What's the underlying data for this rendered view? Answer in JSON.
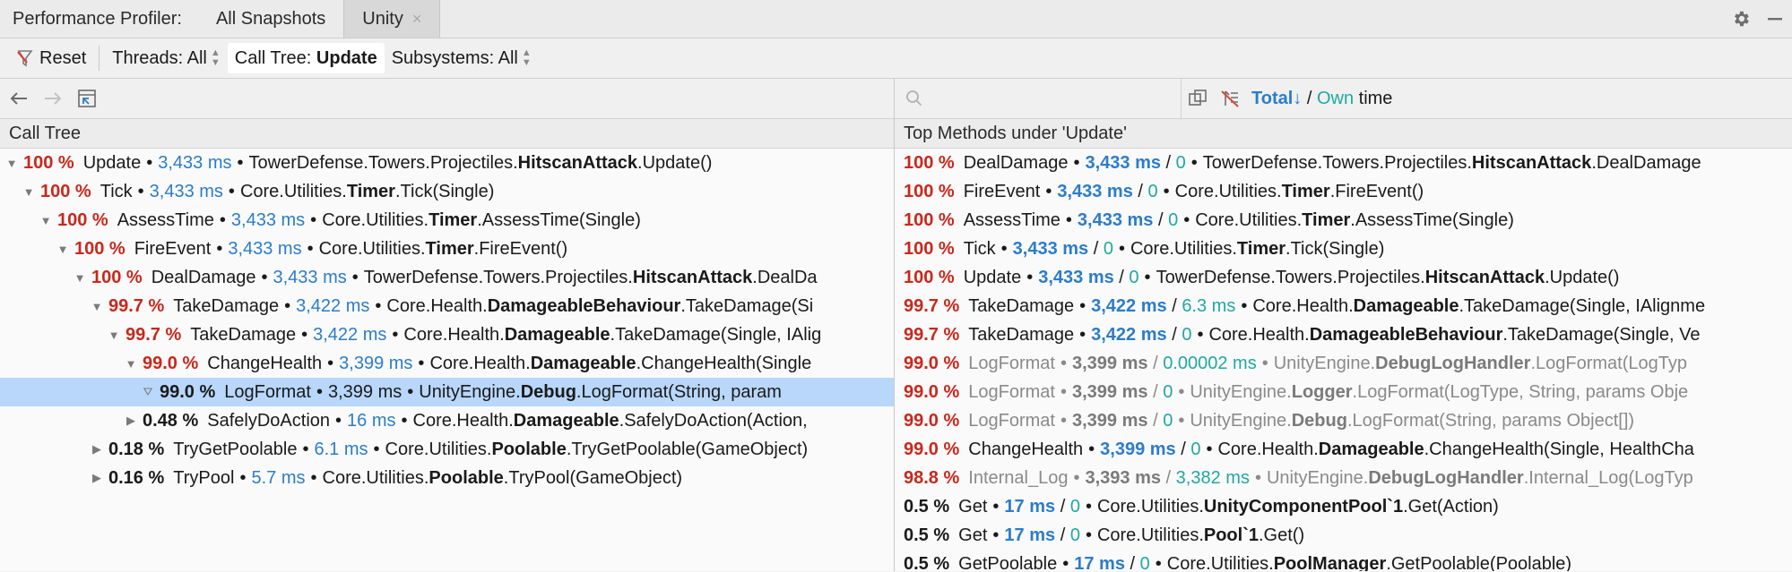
{
  "tabs": {
    "title": "Performance Profiler:",
    "items": [
      {
        "label": "All Snapshots"
      },
      {
        "label": "Unity",
        "close": "×"
      }
    ]
  },
  "toolbar": {
    "reset": "Reset",
    "threads": "Threads: All",
    "calltree_prefix": "Call Tree:",
    "calltree_value": "Update",
    "subsystems": "Subsystems: All"
  },
  "left": {
    "header": "Call Tree",
    "rows": [
      {
        "level": 0,
        "tri": "▼",
        "pct": "100 %",
        "name": "Update",
        "ms": "3,433 ms",
        "ns": "TowerDefense.Towers.Projectiles.",
        "cls": "HitscanAttack",
        "method": ".Update()"
      },
      {
        "level": 1,
        "tri": "▼",
        "pct": "100 %",
        "name": "Tick",
        "ms": "3,433 ms",
        "ns": "Core.Utilities.",
        "cls": "Timer",
        "method": ".Tick(Single)"
      },
      {
        "level": 2,
        "tri": "▼",
        "pct": "100 %",
        "name": "AssessTime",
        "ms": "3,433 ms",
        "ns": "Core.Utilities.",
        "cls": "Timer",
        "method": ".AssessTime(Single)"
      },
      {
        "level": 3,
        "tri": "▼",
        "pct": "100 %",
        "name": "FireEvent",
        "ms": "3,433 ms",
        "ns": "Core.Utilities.",
        "cls": "Timer",
        "method": ".FireEvent()"
      },
      {
        "level": 4,
        "tri": "▼",
        "pct": "100 %",
        "name": "DealDamage",
        "ms": "3,433 ms",
        "ns": "TowerDefense.Towers.Projectiles.",
        "cls": "HitscanAttack",
        "method": ".DealDa"
      },
      {
        "level": 5,
        "tri": "▼",
        "pct": "99.7 %",
        "name": "TakeDamage",
        "ms": "3,422 ms",
        "ns": "Core.Health.",
        "cls": "DamageableBehaviour",
        "method": ".TakeDamage(Si"
      },
      {
        "level": 6,
        "tri": "▼",
        "pct": "99.7 %",
        "name": "TakeDamage",
        "ms": "3,422 ms",
        "ns": "Core.Health.",
        "cls": "Damageable",
        "method": ".TakeDamage(Single, IAlig"
      },
      {
        "level": 7,
        "tri": "▼",
        "pct": "99.0 %",
        "name": "ChangeHealth",
        "ms": "3,399 ms",
        "ns": "Core.Health.",
        "cls": "Damageable",
        "method": ".ChangeHealth(Single"
      },
      {
        "level": 8,
        "tri": "⛛",
        "pct": "99.0 %",
        "name": "LogFormat",
        "ms": "3,399 ms",
        "ns": "UnityEngine.",
        "cls": "Debug",
        "method": ".LogFormat(String, param",
        "selected": true
      },
      {
        "level": 7,
        "tri": "▶",
        "pct": "0.48 %",
        "name": "SafelyDoAction",
        "ms": "16 ms",
        "ns": "Core.Health.",
        "cls": "Damageable",
        "method": ".SafelyDoAction(Action,",
        "dark": true
      },
      {
        "level": 5,
        "tri": "▶",
        "pct": "0.18 %",
        "name": "TryGetPoolable",
        "ms": "6.1 ms",
        "ns": "Core.Utilities.",
        "cls": "Poolable",
        "method": ".TryGetPoolable(GameObject)",
        "dark": true
      },
      {
        "level": 5,
        "tri": "▶",
        "pct": "0.16 %",
        "name": "TryPool",
        "ms": "5.7 ms",
        "ns": "Core.Utilities.",
        "cls": "Poolable",
        "method": ".TryPool(GameObject)",
        "dark": true
      }
    ]
  },
  "right": {
    "search_placeholder": "",
    "time_total": "Total",
    "time_sep": " / ",
    "time_own": "Own",
    "time_suffix": " time",
    "header": "Top Methods under 'Update'",
    "rows": [
      {
        "pct": "100 %",
        "name": "DealDamage",
        "ms": "3,433 ms",
        "own": "0",
        "ns": "TowerDefense.Towers.Projectiles.",
        "cls": "HitscanAttack",
        "method": ".DealDamage"
      },
      {
        "pct": "100 %",
        "name": "FireEvent",
        "ms": "3,433 ms",
        "own": "0",
        "ns": "Core.Utilities.",
        "cls": "Timer",
        "method": ".FireEvent()"
      },
      {
        "pct": "100 %",
        "name": "AssessTime",
        "ms": "3,433 ms",
        "own": "0",
        "ns": "Core.Utilities.",
        "cls": "Timer",
        "method": ".AssessTime(Single)"
      },
      {
        "pct": "100 %",
        "name": "Tick",
        "ms": "3,433 ms",
        "own": "0",
        "ns": "Core.Utilities.",
        "cls": "Timer",
        "method": ".Tick(Single)"
      },
      {
        "pct": "100 %",
        "name": "Update",
        "ms": "3,433 ms",
        "own": "0",
        "ns": "TowerDefense.Towers.Projectiles.",
        "cls": "HitscanAttack",
        "method": ".Update()"
      },
      {
        "pct": "99.7 %",
        "name": "TakeDamage",
        "ms": "3,422 ms",
        "own": "6.3 ms",
        "ns": "Core.Health.",
        "cls": "Damageable",
        "method": ".TakeDamage(Single, IAlignme"
      },
      {
        "pct": "99.7 %",
        "name": "TakeDamage",
        "ms": "3,422 ms",
        "own": "0",
        "ns": "Core.Health.",
        "cls": "DamageableBehaviour",
        "method": ".TakeDamage(Single, Ve"
      },
      {
        "pct": "99.0 %",
        "name": "LogFormat",
        "ms": "3,399 ms",
        "own": "0.00002 ms",
        "ns": "UnityEngine.",
        "cls": "DebugLogHandler",
        "method": ".LogFormat(LogTyp",
        "gray": true
      },
      {
        "pct": "99.0 %",
        "name": "LogFormat",
        "ms": "3,399 ms",
        "own": "0",
        "ns": "UnityEngine.",
        "cls": "Logger",
        "method": ".LogFormat(LogType, String, params Obje",
        "gray": true
      },
      {
        "pct": "99.0 %",
        "name": "LogFormat",
        "ms": "3,399 ms",
        "own": "0",
        "ns": "UnityEngine.",
        "cls": "Debug",
        "method": ".LogFormat(String, params Object[])",
        "gray": true
      },
      {
        "pct": "99.0 %",
        "name": "ChangeHealth",
        "ms": "3,399 ms",
        "own": "0",
        "ns": "Core.Health.",
        "cls": "Damageable",
        "method": ".ChangeHealth(Single, HealthCha"
      },
      {
        "pct": "98.8 %",
        "name": "Internal_Log",
        "ms": "3,393 ms",
        "own": "3,382 ms",
        "ns": "UnityEngine.",
        "cls": "DebugLogHandler",
        "method": ".Internal_Log(LogTyp",
        "gray": true
      },
      {
        "pct": "0.5 %",
        "name": "Get",
        "ms": "17 ms",
        "own": "0",
        "ns": "Core.Utilities.",
        "cls": "UnityComponentPool`1",
        "method": ".Get(Action)",
        "dark": true
      },
      {
        "pct": "0.5 %",
        "name": "Get",
        "ms": "17 ms",
        "own": "0",
        "ns": "Core.Utilities.",
        "cls": "Pool`1",
        "method": ".Get()",
        "dark": true
      },
      {
        "pct": "0.5 %",
        "name": "GetPoolable",
        "ms": "17 ms",
        "own": "0",
        "ns": "Core.Utilities.",
        "cls": "PoolManager",
        "method": ".GetPoolable(Poolable)",
        "dark": true
      }
    ]
  },
  "icons": {
    "settings": "gear-icon",
    "minimize": "minimize-icon",
    "back": "arrow-left-icon",
    "forward": "arrow-right-icon",
    "collapse": "collapse-icon",
    "search": "search-icon",
    "merge": "merge-icon",
    "filter": "filter-off-icon"
  }
}
